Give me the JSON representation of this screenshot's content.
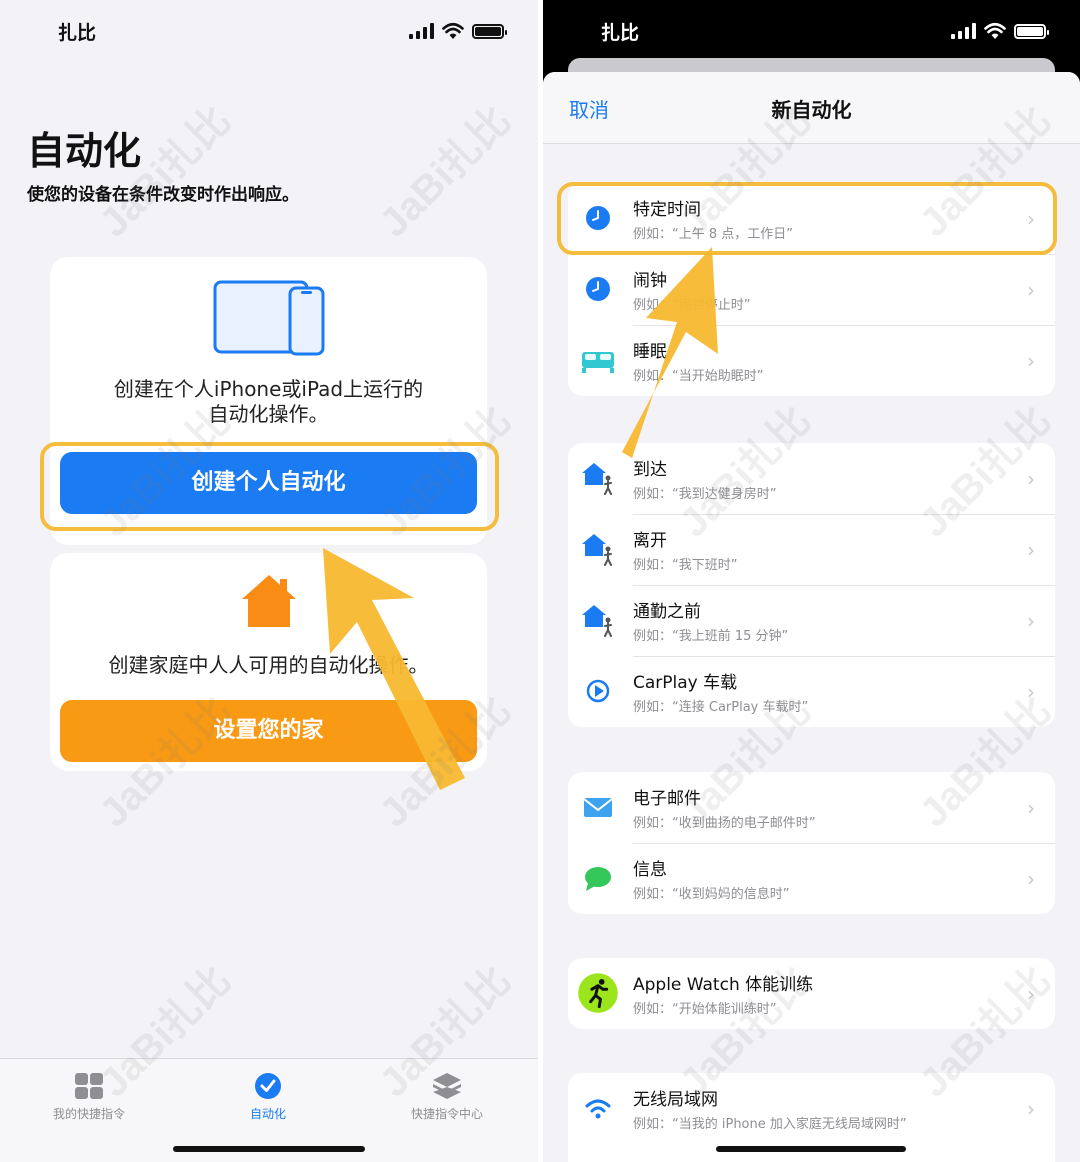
{
  "left": {
    "status": {
      "carrier": "扎比"
    },
    "title": "自动化",
    "subtitle": "使您的设备在条件改变时作出响应。",
    "personal_card": {
      "text": "创建在个人iPhone或iPad上运行的\n自动化操作。",
      "button": "创建个人自动化"
    },
    "home_card": {
      "text": "创建家庭中人人可用的自动化操作。",
      "button": "设置您的家"
    },
    "tabs": [
      {
        "label": "我的快捷指令",
        "icon": "grid-icon"
      },
      {
        "label": "自动化",
        "icon": "automation-check-icon",
        "selected": true
      },
      {
        "label": "快捷指令中心",
        "icon": "layers-icon"
      }
    ]
  },
  "right": {
    "status": {
      "carrier": "扎比"
    },
    "nav": {
      "cancel": "取消",
      "title": "新自动化"
    },
    "groups": [
      [
        {
          "title": "特定时间",
          "sub": "例如：“上午 8 点，工作日”",
          "icon": "clock-icon"
        },
        {
          "title": "闹钟",
          "sub": "例如：“闹钟停止时”",
          "icon": "alarm-clock-icon"
        },
        {
          "title": "睡眠",
          "sub": "例如：“当开始助眠时”",
          "icon": "bed-icon"
        }
      ],
      [
        {
          "title": "到达",
          "sub": "例如：“我到达健身房时”",
          "icon": "home-arrive-icon"
        },
        {
          "title": "离开",
          "sub": "例如：“我下班时”",
          "icon": "home-leave-icon"
        },
        {
          "title": "通勤之前",
          "sub": "例如：“我上班前 15 分钟”",
          "icon": "commute-icon"
        },
        {
          "title": "CarPlay 车载",
          "sub": "例如：“连接 CarPlay 车载时”",
          "icon": "carplay-icon"
        }
      ],
      [
        {
          "title": "电子邮件",
          "sub": "例如：“收到曲扬的电子邮件时”",
          "icon": "mail-icon"
        },
        {
          "title": "信息",
          "sub": "例如：“收到妈妈的信息时”",
          "icon": "message-icon"
        }
      ],
      [
        {
          "title": "Apple Watch 体能训练",
          "sub": "例如：“开始体能训练时”",
          "icon": "workout-icon"
        }
      ],
      [
        {
          "title": "无线局域网",
          "sub": "例如：“当我的 iPhone 加入家庭无线局域网时”",
          "icon": "wifi-icon"
        }
      ]
    ]
  },
  "watermark": "JaBi扎比",
  "colors": {
    "accent_blue": "#1a7bf2",
    "accent_orange": "#f99a14",
    "highlight": "#f5bd3d"
  }
}
